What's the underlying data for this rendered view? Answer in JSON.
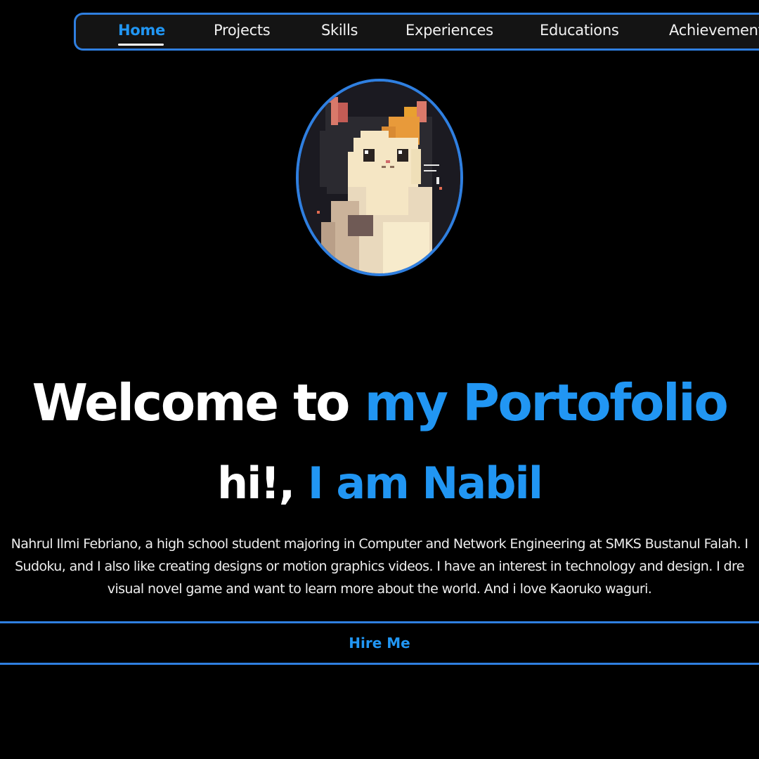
{
  "nav": {
    "items": [
      {
        "label": "Home",
        "active": true
      },
      {
        "label": "Projects",
        "active": false
      },
      {
        "label": "Skills",
        "active": false
      },
      {
        "label": "Experiences",
        "active": false
      },
      {
        "label": "Educations",
        "active": false
      },
      {
        "label": "Achievement",
        "active": false
      }
    ]
  },
  "avatar": {
    "icon": "pixel-art-cat-avatar"
  },
  "hero": {
    "title_part1": "Welcome to",
    "title_part2": "my Portofolio",
    "subtitle_part1": "hi!,",
    "subtitle_part2": "I am Nabil",
    "bio_lines": [
      "Nahrul Ilmi Febriano, a high school student majoring in Computer and Network Engineering at SMKS Bustanul Falah. I",
      "Sudoku, and I also like creating designs or motion graphics videos. I have an interest in technology and design. I dre",
      "visual novel game and want to learn more about the world. And i love Kaoruko waguri."
    ]
  },
  "cta": {
    "hire_label": "Hire Me"
  },
  "colors": {
    "background": "#000000",
    "accent": "#2196f3",
    "border": "#2f7fe0",
    "nav_background": "#141414",
    "text": "#ffffff"
  }
}
